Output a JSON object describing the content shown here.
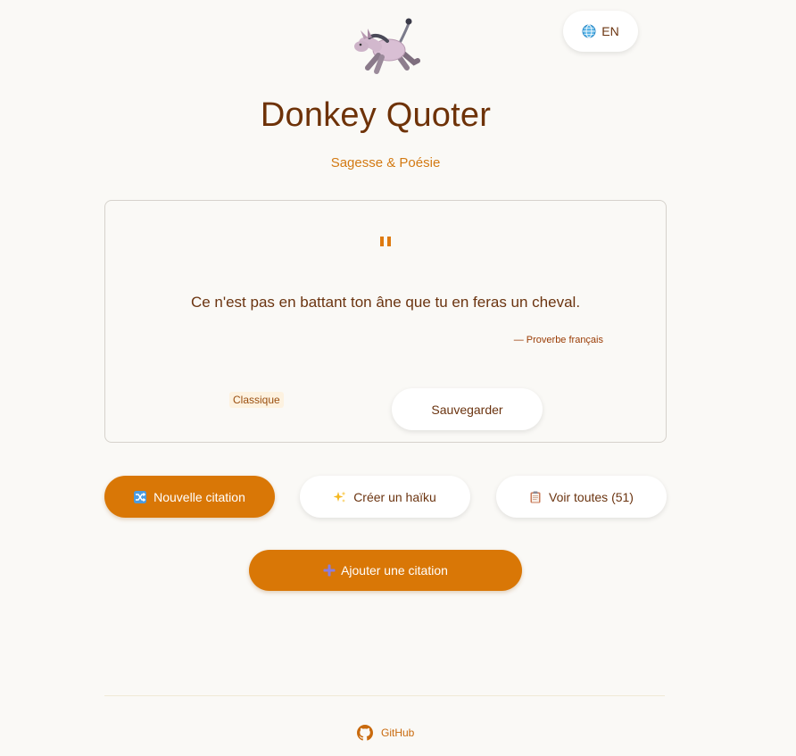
{
  "header": {
    "language_label": "EN",
    "language_icon": "globe-icon",
    "logo_icon": "donkey-icon",
    "title": "Donkey Quoter",
    "subtitle": "Sagesse & Poésie"
  },
  "quote": {
    "text": "Ce n'est pas en battant ton âne que tu en feras un cheval.",
    "author": "— Proverbe français",
    "category": "Classique",
    "save_label": "Sauvegarder",
    "quote_icon": "quote-mark-icon"
  },
  "actions": {
    "new_quote": {
      "label": "Nouvelle citation",
      "icon": "shuffle-icon"
    },
    "create_haiku": {
      "label": "Créer un haïku",
      "icon": "sparkles-icon"
    },
    "view_all": {
      "label": "Voir toutes (51)",
      "icon": "clipboard-icon"
    },
    "add_quote": {
      "label": "Ajouter une citation",
      "icon": "plus-icon"
    }
  },
  "footer": {
    "github_label": "GitHub",
    "github_icon": "github-icon"
  },
  "colors": {
    "accent": "#d97706",
    "background": "#faf9f6",
    "text": "#6b3410",
    "subtitle": "#d37a13"
  }
}
